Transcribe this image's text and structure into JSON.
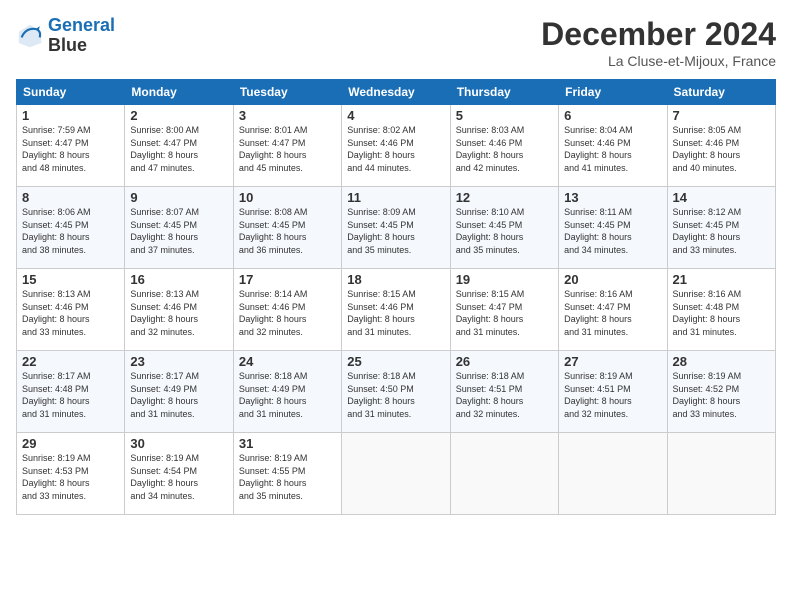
{
  "logo": {
    "line1": "General",
    "line2": "Blue"
  },
  "header": {
    "title": "December 2024",
    "location": "La Cluse-et-Mijoux, France"
  },
  "weekdays": [
    "Sunday",
    "Monday",
    "Tuesday",
    "Wednesday",
    "Thursday",
    "Friday",
    "Saturday"
  ],
  "weeks": [
    [
      {
        "day": "1",
        "sunrise": "7:59 AM",
        "sunset": "4:47 PM",
        "daylight": "8 hours and 48 minutes."
      },
      {
        "day": "2",
        "sunrise": "8:00 AM",
        "sunset": "4:47 PM",
        "daylight": "8 hours and 47 minutes."
      },
      {
        "day": "3",
        "sunrise": "8:01 AM",
        "sunset": "4:47 PM",
        "daylight": "8 hours and 45 minutes."
      },
      {
        "day": "4",
        "sunrise": "8:02 AM",
        "sunset": "4:46 PM",
        "daylight": "8 hours and 44 minutes."
      },
      {
        "day": "5",
        "sunrise": "8:03 AM",
        "sunset": "4:46 PM",
        "daylight": "8 hours and 42 minutes."
      },
      {
        "day": "6",
        "sunrise": "8:04 AM",
        "sunset": "4:46 PM",
        "daylight": "8 hours and 41 minutes."
      },
      {
        "day": "7",
        "sunrise": "8:05 AM",
        "sunset": "4:46 PM",
        "daylight": "8 hours and 40 minutes."
      }
    ],
    [
      {
        "day": "8",
        "sunrise": "8:06 AM",
        "sunset": "4:45 PM",
        "daylight": "8 hours and 38 minutes."
      },
      {
        "day": "9",
        "sunrise": "8:07 AM",
        "sunset": "4:45 PM",
        "daylight": "8 hours and 37 minutes."
      },
      {
        "day": "10",
        "sunrise": "8:08 AM",
        "sunset": "4:45 PM",
        "daylight": "8 hours and 36 minutes."
      },
      {
        "day": "11",
        "sunrise": "8:09 AM",
        "sunset": "4:45 PM",
        "daylight": "8 hours and 35 minutes."
      },
      {
        "day": "12",
        "sunrise": "8:10 AM",
        "sunset": "4:45 PM",
        "daylight": "8 hours and 35 minutes."
      },
      {
        "day": "13",
        "sunrise": "8:11 AM",
        "sunset": "4:45 PM",
        "daylight": "8 hours and 34 minutes."
      },
      {
        "day": "14",
        "sunrise": "8:12 AM",
        "sunset": "4:45 PM",
        "daylight": "8 hours and 33 minutes."
      }
    ],
    [
      {
        "day": "15",
        "sunrise": "8:13 AM",
        "sunset": "4:46 PM",
        "daylight": "8 hours and 33 minutes."
      },
      {
        "day": "16",
        "sunrise": "8:13 AM",
        "sunset": "4:46 PM",
        "daylight": "8 hours and 32 minutes."
      },
      {
        "day": "17",
        "sunrise": "8:14 AM",
        "sunset": "4:46 PM",
        "daylight": "8 hours and 32 minutes."
      },
      {
        "day": "18",
        "sunrise": "8:15 AM",
        "sunset": "4:46 PM",
        "daylight": "8 hours and 31 minutes."
      },
      {
        "day": "19",
        "sunrise": "8:15 AM",
        "sunset": "4:47 PM",
        "daylight": "8 hours and 31 minutes."
      },
      {
        "day": "20",
        "sunrise": "8:16 AM",
        "sunset": "4:47 PM",
        "daylight": "8 hours and 31 minutes."
      },
      {
        "day": "21",
        "sunrise": "8:16 AM",
        "sunset": "4:48 PM",
        "daylight": "8 hours and 31 minutes."
      }
    ],
    [
      {
        "day": "22",
        "sunrise": "8:17 AM",
        "sunset": "4:48 PM",
        "daylight": "8 hours and 31 minutes."
      },
      {
        "day": "23",
        "sunrise": "8:17 AM",
        "sunset": "4:49 PM",
        "daylight": "8 hours and 31 minutes."
      },
      {
        "day": "24",
        "sunrise": "8:18 AM",
        "sunset": "4:49 PM",
        "daylight": "8 hours and 31 minutes."
      },
      {
        "day": "25",
        "sunrise": "8:18 AM",
        "sunset": "4:50 PM",
        "daylight": "8 hours and 31 minutes."
      },
      {
        "day": "26",
        "sunrise": "8:18 AM",
        "sunset": "4:51 PM",
        "daylight": "8 hours and 32 minutes."
      },
      {
        "day": "27",
        "sunrise": "8:19 AM",
        "sunset": "4:51 PM",
        "daylight": "8 hours and 32 minutes."
      },
      {
        "day": "28",
        "sunrise": "8:19 AM",
        "sunset": "4:52 PM",
        "daylight": "8 hours and 33 minutes."
      }
    ],
    [
      {
        "day": "29",
        "sunrise": "8:19 AM",
        "sunset": "4:53 PM",
        "daylight": "8 hours and 33 minutes."
      },
      {
        "day": "30",
        "sunrise": "8:19 AM",
        "sunset": "4:54 PM",
        "daylight": "8 hours and 34 minutes."
      },
      {
        "day": "31",
        "sunrise": "8:19 AM",
        "sunset": "4:55 PM",
        "daylight": "8 hours and 35 minutes."
      },
      null,
      null,
      null,
      null
    ]
  ]
}
